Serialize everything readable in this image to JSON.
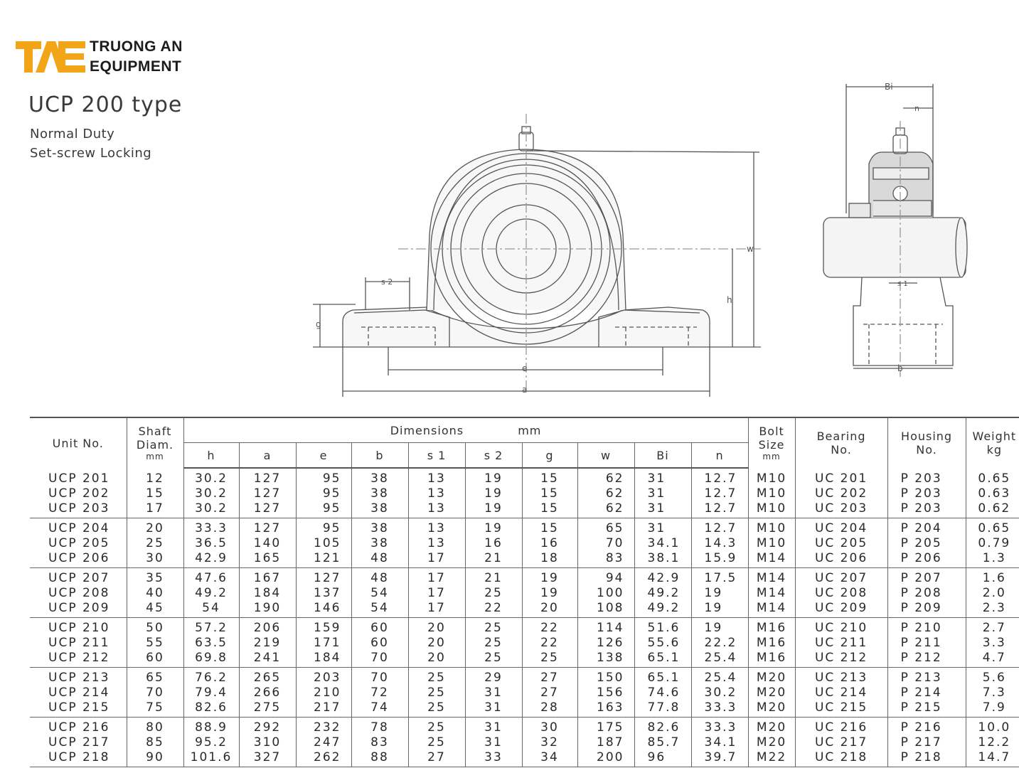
{
  "logo": {
    "mark": "TAE",
    "line1": "TRUONG AN",
    "line2": "EQUIPMENT",
    "accent": "#f2a516"
  },
  "heading": {
    "title": "UCP  200  type",
    "subtitle1": "Normal Duty",
    "subtitle2": "Set-screw Locking"
  },
  "drawing": {
    "labels": {
      "w": "w",
      "h": "h",
      "g": "g",
      "s2": "s 2",
      "e": "e",
      "a": "a",
      "bi": "Bi",
      "n": "n",
      "s1": "s 1",
      "b": "b"
    }
  },
  "table": {
    "headers": {
      "unit_no": "Unit  No.",
      "shaft_1": "Shaft",
      "shaft_2": "Diam.",
      "shaft_3": "mm",
      "dimensions": "Dimensions",
      "dimensions_unit": "mm",
      "h": "h",
      "a": "a",
      "e": "e",
      "b": "b",
      "s1": "s 1",
      "s2": "s 2",
      "g": "g",
      "w": "w",
      "bi": "Bi",
      "n": "n",
      "bolt_1": "Bolt",
      "bolt_2": "Size",
      "bolt_3": "mm",
      "bearing_1": "Bearing",
      "bearing_2": "No.",
      "housing_1": "Housing",
      "housing_2": "No.",
      "weight_1": "Weight",
      "weight_2": "kg"
    },
    "rows": [
      [
        "UCP  201",
        "12",
        "30.2",
        "127",
        "95",
        "38",
        "13",
        "19",
        "15",
        "62",
        "31",
        "12.7",
        "M10",
        "UC  201",
        "P  203",
        "0.65"
      ],
      [
        "UCP  202",
        "15",
        "30.2",
        "127",
        "95",
        "38",
        "13",
        "19",
        "15",
        "62",
        "31",
        "12.7",
        "M10",
        "UC  202",
        "P  203",
        "0.63"
      ],
      [
        "UCP  203",
        "17",
        "30.2",
        "127",
        "95",
        "38",
        "13",
        "19",
        "15",
        "62",
        "31",
        "12.7",
        "M10",
        "UC  203",
        "P  203",
        "0.62"
      ],
      [
        "UCP  204",
        "20",
        "33.3",
        "127",
        "95",
        "38",
        "13",
        "19",
        "15",
        "65",
        "31",
        "12.7",
        "M10",
        "UC  204",
        "P  204",
        "0.65"
      ],
      [
        "UCP  205",
        "25",
        "36.5",
        "140",
        "105",
        "38",
        "13",
        "16",
        "16",
        "70",
        "34.1",
        "14.3",
        "M10",
        "UC  205",
        "P  205",
        "0.79"
      ],
      [
        "UCP  206",
        "30",
        "42.9",
        "165",
        "121",
        "48",
        "17",
        "21",
        "18",
        "83",
        "38.1",
        "15.9",
        "M14",
        "UC  206",
        "P  206",
        "1.3"
      ],
      [
        "UCP  207",
        "35",
        "47.6",
        "167",
        "127",
        "48",
        "17",
        "21",
        "19",
        "94",
        "42.9",
        "17.5",
        "M14",
        "UC  207",
        "P  207",
        "1.6"
      ],
      [
        "UCP  208",
        "40",
        "49.2",
        "184",
        "137",
        "54",
        "17",
        "25",
        "19",
        "100",
        "49.2",
        "19",
        "M14",
        "UC  208",
        "P  208",
        "2.0"
      ],
      [
        "UCP  209",
        "45",
        "54",
        "190",
        "146",
        "54",
        "17",
        "22",
        "20",
        "108",
        "49.2",
        "19",
        "M14",
        "UC  209",
        "P  209",
        "2.3"
      ],
      [
        "UCP  210",
        "50",
        "57.2",
        "206",
        "159",
        "60",
        "20",
        "25",
        "22",
        "114",
        "51.6",
        "19",
        "M16",
        "UC  210",
        "P  210",
        "2.7"
      ],
      [
        "UCP  211",
        "55",
        "63.5",
        "219",
        "171",
        "60",
        "20",
        "25",
        "22",
        "126",
        "55.6",
        "22.2",
        "M16",
        "UC  211",
        "P  211",
        "3.3"
      ],
      [
        "UCP  212",
        "60",
        "69.8",
        "241",
        "184",
        "70",
        "20",
        "25",
        "25",
        "138",
        "65.1",
        "25.4",
        "M16",
        "UC  212",
        "P  212",
        "4.7"
      ],
      [
        "UCP  213",
        "65",
        "76.2",
        "265",
        "203",
        "70",
        "25",
        "29",
        "27",
        "150",
        "65.1",
        "25.4",
        "M20",
        "UC  213",
        "P  213",
        "5.6"
      ],
      [
        "UCP  214",
        "70",
        "79.4",
        "266",
        "210",
        "72",
        "25",
        "31",
        "27",
        "156",
        "74.6",
        "30.2",
        "M20",
        "UC  214",
        "P  214",
        "7.3"
      ],
      [
        "UCP  215",
        "75",
        "82.6",
        "275",
        "217",
        "74",
        "25",
        "31",
        "28",
        "163",
        "77.8",
        "33.3",
        "M20",
        "UC  215",
        "P  215",
        "7.9"
      ],
      [
        "UCP  216",
        "80",
        "88.9",
        "292",
        "232",
        "78",
        "25",
        "31",
        "30",
        "175",
        "82.6",
        "33.3",
        "M20",
        "UC  216",
        "P  216",
        "10.0"
      ],
      [
        "UCP  217",
        "85",
        "95.2",
        "310",
        "247",
        "83",
        "25",
        "31",
        "32",
        "187",
        "85.7",
        "34.1",
        "M20",
        "UC  217",
        "P  217",
        "12.2"
      ],
      [
        "UCP  218",
        "90",
        "101.6",
        "327",
        "262",
        "88",
        "27",
        "33",
        "34",
        "200",
        "96",
        "39.7",
        "M22",
        "UC  218",
        "P  218",
        "14.7"
      ]
    ]
  }
}
